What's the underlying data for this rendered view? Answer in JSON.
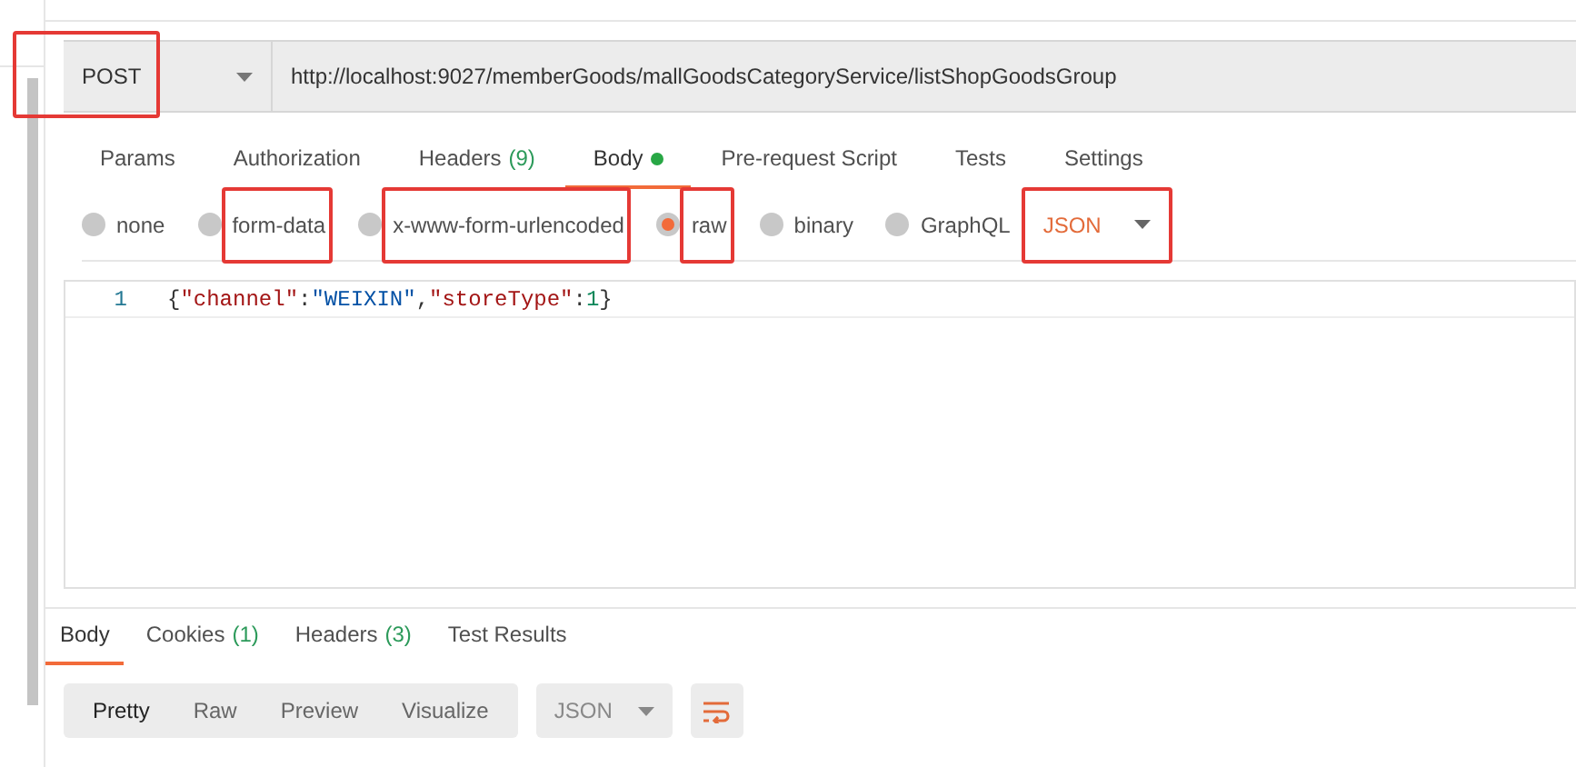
{
  "request": {
    "method": "POST",
    "method_highlighted": true,
    "url": "http://localhost:9027/memberGoods/mallGoodsCategoryService/listShopGoodsGroup"
  },
  "request_tabs": [
    {
      "label": "Params",
      "selected": false,
      "dot": false
    },
    {
      "label": "Authorization",
      "selected": false,
      "dot": false
    },
    {
      "label": "Headers",
      "count": "(9)",
      "selected": false,
      "dot": false
    },
    {
      "label": "Body",
      "selected": true,
      "dot": true
    },
    {
      "label": "Pre-request Script",
      "selected": false,
      "dot": false
    },
    {
      "label": "Tests",
      "selected": false,
      "dot": false
    },
    {
      "label": "Settings",
      "selected": false,
      "dot": false
    }
  ],
  "body_types": [
    {
      "label": "none",
      "selected": false,
      "highlighted": false
    },
    {
      "label": "form-data",
      "selected": false,
      "highlighted": true
    },
    {
      "label": "x-www-form-urlencoded",
      "selected": false,
      "highlighted": true
    },
    {
      "label": "raw",
      "selected": true,
      "highlighted": true
    },
    {
      "label": "binary",
      "selected": false,
      "highlighted": false
    },
    {
      "label": "GraphQL",
      "selected": false,
      "highlighted": false
    }
  ],
  "language": {
    "label": "JSON",
    "highlighted": true
  },
  "editor": {
    "lines": [
      {
        "number": "1",
        "tokens": [
          {
            "kind": "punct",
            "text": "{"
          },
          {
            "kind": "key",
            "text": "\"channel\""
          },
          {
            "kind": "punct",
            "text": ":"
          },
          {
            "kind": "string",
            "text": "\"WEIXIN\""
          },
          {
            "kind": "punct",
            "text": ","
          },
          {
            "kind": "key",
            "text": "\"storeType\""
          },
          {
            "kind": "punct",
            "text": ":"
          },
          {
            "kind": "number",
            "text": "1"
          },
          {
            "kind": "punct",
            "text": "}"
          }
        ]
      }
    ]
  },
  "response_tabs": [
    {
      "label": "Body",
      "selected": true
    },
    {
      "label": "Cookies",
      "count": "(1)",
      "selected": false
    },
    {
      "label": "Headers",
      "count": "(3)",
      "selected": false
    },
    {
      "label": "Test Results",
      "selected": false
    }
  ],
  "response_views": [
    {
      "label": "Pretty",
      "selected": true
    },
    {
      "label": "Raw",
      "selected": false
    },
    {
      "label": "Preview",
      "selected": false
    },
    {
      "label": "Visualize",
      "selected": false
    }
  ],
  "response_format": "JSON"
}
